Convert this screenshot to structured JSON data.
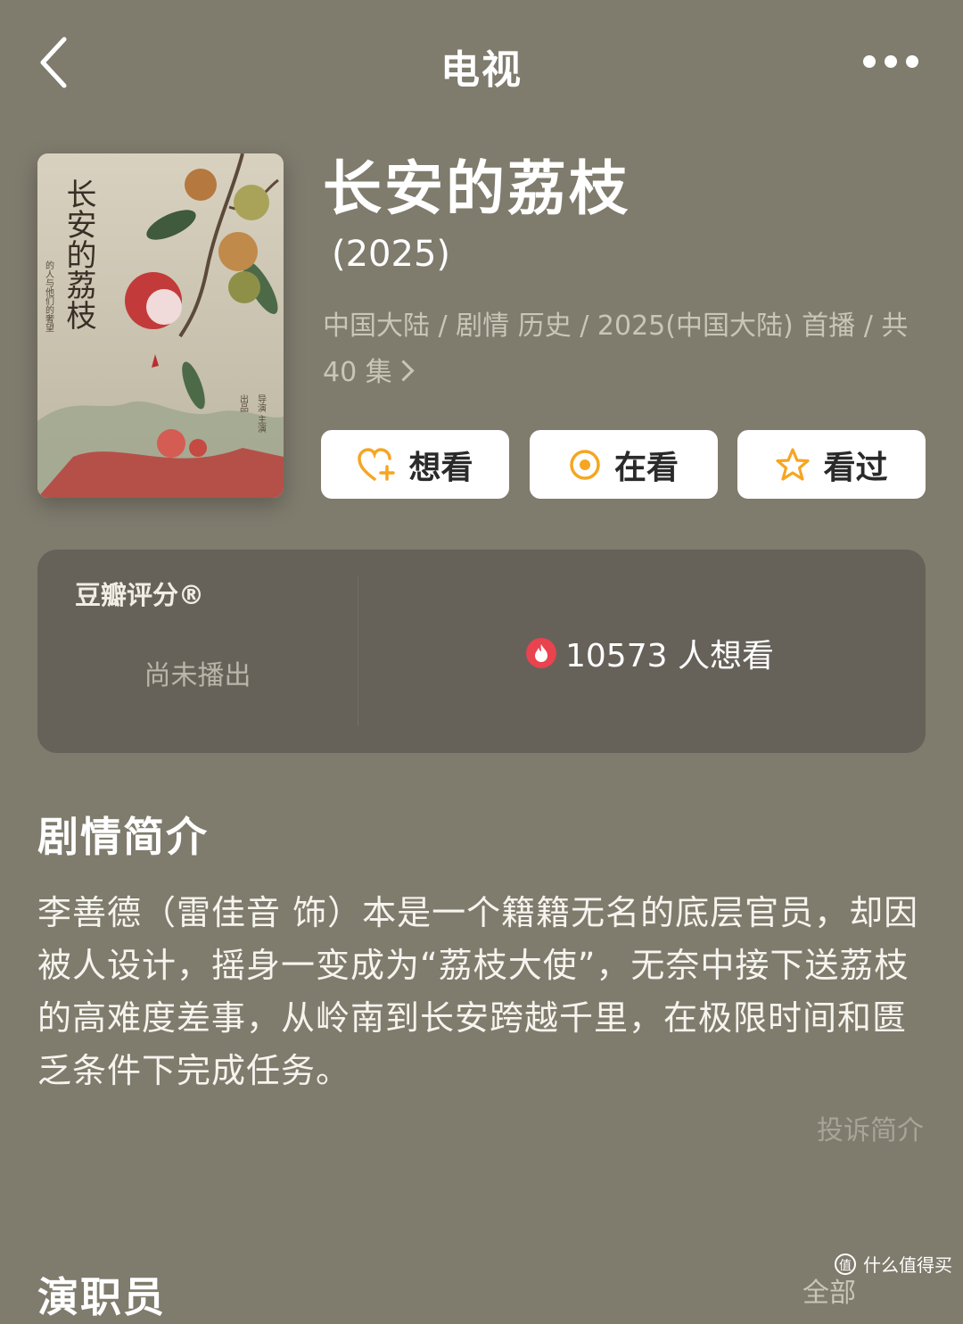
{
  "nav": {
    "title": "电视",
    "back_icon": "chevron-left-icon",
    "more_icon": "more-dots-icon"
  },
  "show": {
    "title": "长安的荔枝",
    "year": "(2025)",
    "meta_line": "中国大陆 / 剧情 历史 / 2025(中国大陆) 首播 / 共",
    "episodes": "40 集",
    "poster_title": "长安的荔枝"
  },
  "actions": [
    {
      "label": "想看",
      "icon": "heart-plus-icon"
    },
    {
      "label": "在看",
      "icon": "target-circle-icon"
    },
    {
      "label": "看过",
      "icon": "star-icon"
    }
  ],
  "rating": {
    "label": "豆瓣评分®",
    "status": "尚未播出",
    "want_count": "10573 人想看",
    "want_icon": "fire-icon"
  },
  "synopsis": {
    "title": "剧情简介",
    "text": "李善德（雷佳音 饰）本是一个籍籍无名的底层官员，却因被人设计，摇身一变成为“荔枝大使”，无奈中接下送荔枝的高难度差事，从岭南到长安跨越千里，在极限时间和匮乏条件下完成任务。",
    "report": "投诉简介"
  },
  "cast": {
    "title": "演职员",
    "all": "全部"
  },
  "watermark": {
    "logo": "值",
    "text": "什么值得买"
  },
  "colors": {
    "background": "#7f7b6d",
    "card": "#66625a",
    "accent": "#f5a623",
    "fire": "#e8434f"
  }
}
